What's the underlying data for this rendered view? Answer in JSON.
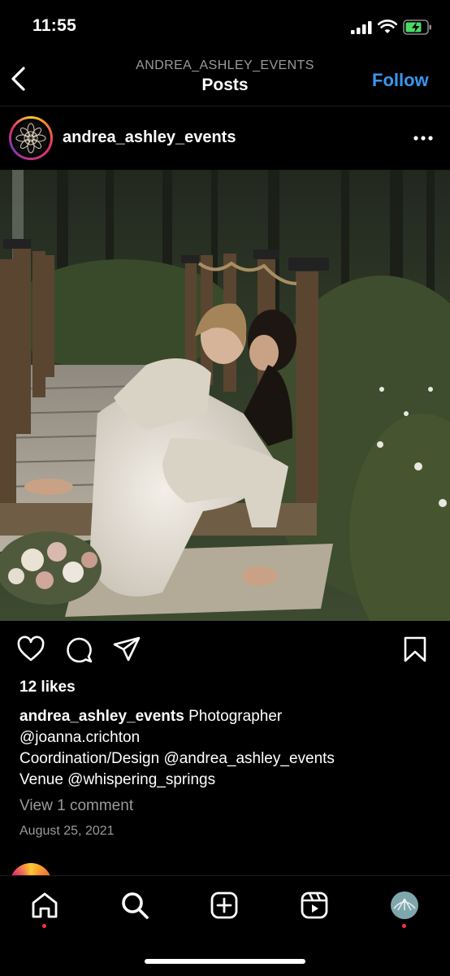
{
  "status_bar": {
    "time": "11:55"
  },
  "header": {
    "account": "ANDREA_ASHLEY_EVENTS",
    "title": "Posts",
    "follow_label": "Follow"
  },
  "post": {
    "username": "andrea_ashley_events",
    "likes": "12 likes",
    "caption": {
      "username": "andrea_ashley_events",
      "line1": "Photographer",
      "line2": "@joanna.crichton",
      "line3": "Coordination/Design @andrea_ashley_events",
      "line4": "Venue @whispering_springs"
    },
    "view_comments": "View 1 comment",
    "date": "August 25, 2021"
  },
  "colors": {
    "accent": "#3897f0",
    "background": "#000000",
    "muted_text": "#9a9a9a",
    "notification_dot": "#ff3040"
  },
  "icons": {
    "back": "chevron-left-icon",
    "more": "more-horizontal-icon",
    "like": "heart-icon",
    "comment": "comment-icon",
    "share": "paper-plane-icon",
    "save": "bookmark-icon",
    "tabs": [
      "home-icon",
      "search-icon",
      "new-post-icon",
      "reels-icon",
      "profile-avatar"
    ]
  }
}
